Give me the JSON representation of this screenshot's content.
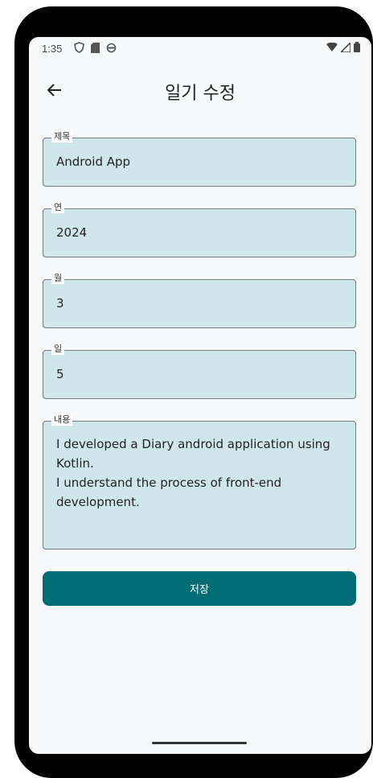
{
  "status_bar": {
    "time": "1:35",
    "left_icons": [
      "vpn-shield-icon",
      "sd-card-icon",
      "sync-icon"
    ],
    "right_icons": [
      "wifi-icon",
      "signal-icon",
      "battery-icon"
    ]
  },
  "appbar": {
    "back_icon": "arrow-left-icon",
    "title": "일기 수정"
  },
  "form": {
    "title_field": {
      "label": "제목",
      "value": "Android App"
    },
    "year_field": {
      "label": "연",
      "value": "2024"
    },
    "month_field": {
      "label": "월",
      "value": "3"
    },
    "day_field": {
      "label": "일",
      "value": "5"
    },
    "content_field": {
      "label": "내용",
      "value": "I developed a Diary android application using Kotlin.\nI understand the process of front-end development."
    }
  },
  "save_button": {
    "label": "저장"
  },
  "colors": {
    "field_bg": "#cfe6ec",
    "accent": "#006c74"
  }
}
